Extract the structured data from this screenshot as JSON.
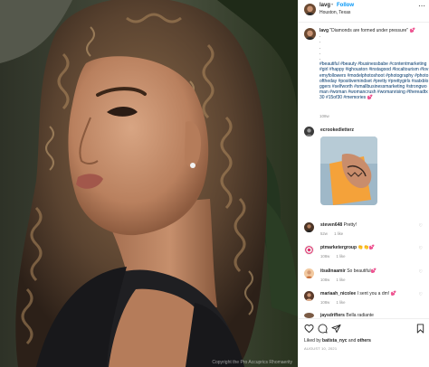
{
  "header": {
    "username": "lavg",
    "separator": "•",
    "follow_label": "Follow",
    "location": "Houston, Texas",
    "more_icon": "more-horizontal-icon"
  },
  "caption": {
    "username": "lavg",
    "text": "\"Diamonds are formed under pressure\" 💕",
    "dots": [
      ".",
      ".",
      ".",
      ".",
      "."
    ],
    "hashtags": "#beautiful #beauty #businessbabe #contentmarketing #girl #happy #ighouston #instagood #localtourism #lovemyfollowers #modelphotoshoot #photography #photooftheday #positivemindset #pretty #prettygirls #satxbloggers #selfworth #smallbusinessmarketing #strongwoman #woman #womancrush #womanrising #thereadtx30 #15of30 #memories 💕",
    "time": "108w"
  },
  "comments": [
    {
      "username": "ecrookedletterz",
      "text": "",
      "meta": [
        "",
        ""
      ]
    },
    {
      "username": "steven648",
      "text": "Pretty!",
      "meta": [
        "52w",
        "1 like"
      ]
    },
    {
      "username": "ptmarketergroup",
      "text": "👏👏💕",
      "meta": [
        "108w",
        "1 like"
      ]
    },
    {
      "username": "itsalinaamir",
      "text": "So beautiful💕",
      "meta": [
        "108w",
        "1 like"
      ]
    },
    {
      "username": "mariaah_nicolee",
      "text": "I sent you a dm! 💕",
      "meta": [
        "108w",
        "1 like"
      ]
    },
    {
      "username": "jaysdrifters",
      "text": "Bella radiante",
      "meta": [
        "",
        ""
      ]
    }
  ],
  "actions": {
    "like_icon": "heart-icon",
    "comment_icon": "comment-icon",
    "share_icon": "paper-plane-icon",
    "save_icon": "bookmark-icon"
  },
  "likes": {
    "prefix": "Liked by",
    "user": "batista_nyc",
    "middle": "and",
    "others": "others"
  },
  "post_date": "AUGUST 10, 2021",
  "photo_credit": "Copyright the Pro Accuprics Rhomaerity",
  "colors": {
    "accent": "#0095f6",
    "hashtag": "#00376b",
    "muted": "#8e8e8e"
  }
}
